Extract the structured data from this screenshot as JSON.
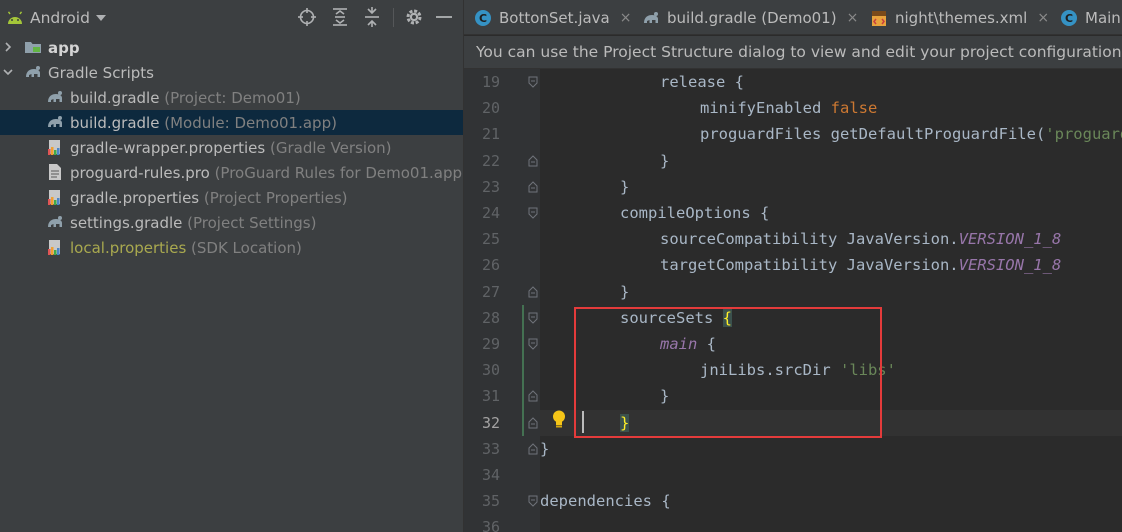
{
  "project_panel": {
    "view_selector": "Android",
    "tree": [
      {
        "label": "app",
        "sub": "",
        "depth": 0,
        "arrow": "right",
        "icon": "folder-icon",
        "style": "bold"
      },
      {
        "label": "Gradle Scripts",
        "sub": "",
        "depth": 0,
        "arrow": "down",
        "icon": "gradle-icon",
        "style": "normal"
      },
      {
        "label": "build.gradle",
        "sub": " (Project: Demo01)",
        "depth": 1,
        "arrow": "",
        "icon": "gradle-icon",
        "style": "normal"
      },
      {
        "label": "build.gradle",
        "sub": " (Module: Demo01.app)",
        "depth": 1,
        "arrow": "",
        "icon": "gradle-icon",
        "style": "normal",
        "selected": true
      },
      {
        "label": "gradle-wrapper.properties",
        "sub": " (Gradle Version)",
        "depth": 1,
        "arrow": "",
        "icon": "properties-icon",
        "style": "normal"
      },
      {
        "label": "proguard-rules.pro",
        "sub": " (ProGuard Rules for Demo01.app)",
        "depth": 1,
        "arrow": "",
        "icon": "text-file-icon",
        "style": "normal"
      },
      {
        "label": "gradle.properties",
        "sub": " (Project Properties)",
        "depth": 1,
        "arrow": "",
        "icon": "properties-icon",
        "style": "normal"
      },
      {
        "label": "settings.gradle",
        "sub": " (Project Settings)",
        "depth": 1,
        "arrow": "",
        "icon": "gradle-icon",
        "style": "normal"
      },
      {
        "label": "local.properties",
        "sub": " (SDK Location)",
        "depth": 1,
        "arrow": "",
        "icon": "properties-icon",
        "style": "warn"
      }
    ]
  },
  "editor": {
    "tabs": [
      {
        "label": "BottonSet.java",
        "icon": "java-class-icon",
        "close": "×"
      },
      {
        "label": "build.gradle (Demo01)",
        "icon": "gradle-icon",
        "close": "×"
      },
      {
        "label": "night\\themes.xml",
        "icon": "xml-file-icon",
        "close": "×"
      },
      {
        "label": "Main",
        "icon": "java-class-icon",
        "close": ""
      }
    ],
    "notification": "You can use the Project Structure dialog to view and edit your project configuration",
    "current_line": 32,
    "lines": [
      {
        "n": 19,
        "indent": 3,
        "tokens": [
          {
            "t": "release {",
            "c": ""
          }
        ]
      },
      {
        "n": 20,
        "indent": 4,
        "tokens": [
          {
            "t": "minifyEnabled ",
            "c": ""
          },
          {
            "t": "false",
            "c": "kw"
          }
        ]
      },
      {
        "n": 21,
        "indent": 4,
        "tokens": [
          {
            "t": "proguardFiles getDefaultProguardFile(",
            "c": ""
          },
          {
            "t": "'proguard",
            "c": "str"
          }
        ]
      },
      {
        "n": 22,
        "indent": 3,
        "tokens": [
          {
            "t": "}",
            "c": ""
          }
        ]
      },
      {
        "n": 23,
        "indent": 2,
        "tokens": [
          {
            "t": "}",
            "c": ""
          }
        ]
      },
      {
        "n": 24,
        "indent": 2,
        "tokens": [
          {
            "t": "compileOptions {",
            "c": ""
          }
        ]
      },
      {
        "n": 25,
        "indent": 3,
        "tokens": [
          {
            "t": "sourceCompatibility JavaVersion.",
            "c": ""
          },
          {
            "t": "VERSION_1_8",
            "c": "const"
          }
        ]
      },
      {
        "n": 26,
        "indent": 3,
        "tokens": [
          {
            "t": "targetCompatibility JavaVersion.",
            "c": ""
          },
          {
            "t": "VERSION_1_8",
            "c": "const"
          }
        ]
      },
      {
        "n": 27,
        "indent": 2,
        "tokens": [
          {
            "t": "}",
            "c": ""
          }
        ]
      },
      {
        "n": 28,
        "indent": 2,
        "tokens": [
          {
            "t": "sourceSets ",
            "c": ""
          },
          {
            "t": "{",
            "c": "bracehl"
          }
        ]
      },
      {
        "n": 29,
        "indent": 3,
        "tokens": [
          {
            "t": "main",
            "c": "const"
          },
          {
            "t": " {",
            "c": ""
          }
        ]
      },
      {
        "n": 30,
        "indent": 4,
        "tokens": [
          {
            "t": "jniLibs.srcDir ",
            "c": ""
          },
          {
            "t": "'libs'",
            "c": "str"
          }
        ]
      },
      {
        "n": 31,
        "indent": 3,
        "tokens": [
          {
            "t": "}",
            "c": ""
          }
        ]
      },
      {
        "n": 32,
        "indent": 2,
        "tokens": [
          {
            "t": "}",
            "c": "bracehl"
          }
        ]
      },
      {
        "n": 33,
        "indent": 0,
        "tokens": [
          {
            "t": "}",
            "c": ""
          }
        ]
      },
      {
        "n": 34,
        "indent": 0,
        "tokens": []
      },
      {
        "n": 35,
        "indent": 0,
        "tokens": [
          {
            "t": "dependencies {",
            "c": ""
          }
        ]
      },
      {
        "n": 36,
        "indent": 0,
        "tokens": []
      }
    ]
  },
  "colors": {
    "panel_bg": "#3c3f41",
    "editor_bg": "#2b2b2b",
    "selection": "#0d293e",
    "keyword": "#cc7832",
    "string": "#6a8759",
    "constant": "#9876aa",
    "highlight_box": "#e43b3b",
    "android_green": "#a4c639"
  }
}
